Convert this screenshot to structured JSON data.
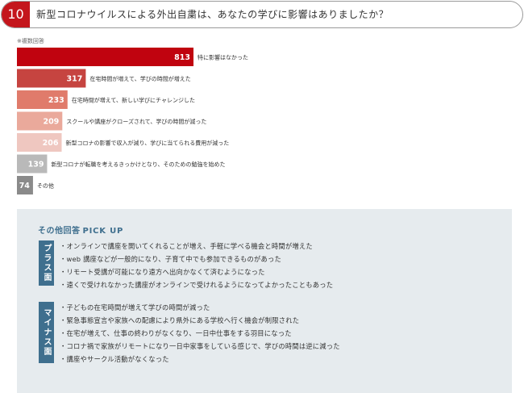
{
  "question": {
    "number": "10",
    "title": "新型コロナウイルスによる外出自粛は、あなたの学びに影響はありましたか？"
  },
  "note": "※複数回答",
  "chart_data": {
    "type": "bar",
    "orientation": "horizontal",
    "categories": [
      "特に影響はなかった",
      "在宅時間が増えて、学びの時間が増えた",
      "在宅時間が増えて、新しい学びにチャレンジした",
      "スクールや講座がクローズされて、学びの時間が減った",
      "新型コロナの影響で収入が減り、学びに当てられる費用が減った",
      "新型コロナが転職を考えるきっかけとなり、そのための勉強を始めた",
      "その他"
    ],
    "values": [
      813,
      317,
      233,
      209,
      206,
      139,
      74
    ],
    "colors": [
      "#c0030f",
      "#c64440",
      "#e07b6b",
      "#eaa99b",
      "#efc7c0",
      "#b9b9b9",
      "#8a8a8a"
    ],
    "xlim": [
      0,
      813
    ],
    "grid": false
  },
  "pickup": {
    "title": "その他回答",
    "title_en": "PICK UP",
    "plus": {
      "label": "プラス面",
      "items": [
        "オンラインで講座を開いてくれることが増え、手軽に学べる機会と時間が増えた",
        "web 講座などが一般的になり、子育て中でも参加できるものがあった",
        "リモート受講が可能になり遠方へ出向かなくて済むようになった",
        "遠くで受けれなかった講座がオンラインで受けれるようになってよかったこともあった"
      ]
    },
    "minus": {
      "label": "マイナス面",
      "items": [
        "子どもの在宅時間が増えて学びの時間が減った",
        "緊急事態宣言や家族への配慮により県外にある学校へ行く機会が制限された",
        "在宅が増えて、仕事の終わりがなくなり、一日中仕事をする羽目になった",
        "コロナ禍で家族がリモートになり一日中家事をしている感じで、学びの時間は逆に減った",
        "講座やサークル活動がなくなった"
      ]
    }
  }
}
